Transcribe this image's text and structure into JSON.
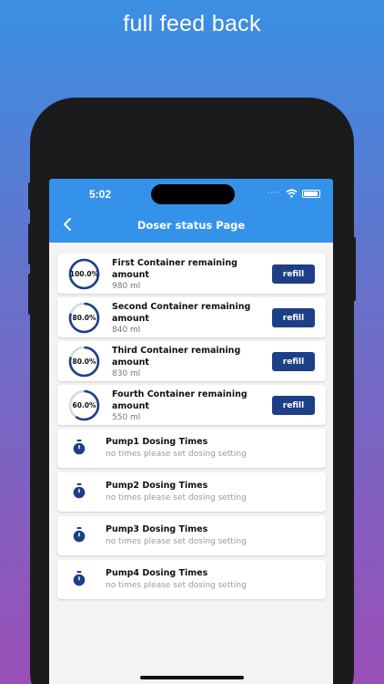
{
  "headline": "full feed back",
  "status_bar": {
    "time": "5:02",
    "signal": "····"
  },
  "app_bar": {
    "title": "Doser status Page",
    "back_icon": "chevron-left-icon"
  },
  "containers": [
    {
      "title": "First Container remaining amount",
      "amount": "980 ml",
      "percent_label": "100.0%",
      "fraction": 1.0,
      "button": "refill"
    },
    {
      "title": "Second Container remaining amount",
      "amount": "840 ml",
      "percent_label": "80.0%",
      "fraction": 0.8,
      "button": "refill"
    },
    {
      "title": "Third Container remaining amount",
      "amount": "830 ml",
      "percent_label": "80.0%",
      "fraction": 0.8,
      "button": "refill"
    },
    {
      "title": "Fourth Container remaining amount",
      "amount": "550 ml",
      "percent_label": "60.0%",
      "fraction": 0.6,
      "button": "refill"
    }
  ],
  "pumps": [
    {
      "title": "Pump1 Dosing Times",
      "subtitle": "no times please set dosing setting",
      "icon": "timer-icon"
    },
    {
      "title": "Pump2 Dosing Times",
      "subtitle": "no times please set dosing setting",
      "icon": "timer-icon"
    },
    {
      "title": "Pump3 Dosing Times",
      "subtitle": "no times please set dosing setting",
      "icon": "timer-icon"
    },
    {
      "title": "Pump4 Dosing Times",
      "subtitle": "no times please set dosing setting",
      "icon": "timer-icon"
    }
  ],
  "colors": {
    "app_bar": "#3492ea",
    "accent": "#1c3f86",
    "ring_track": "#d6d9e0"
  }
}
